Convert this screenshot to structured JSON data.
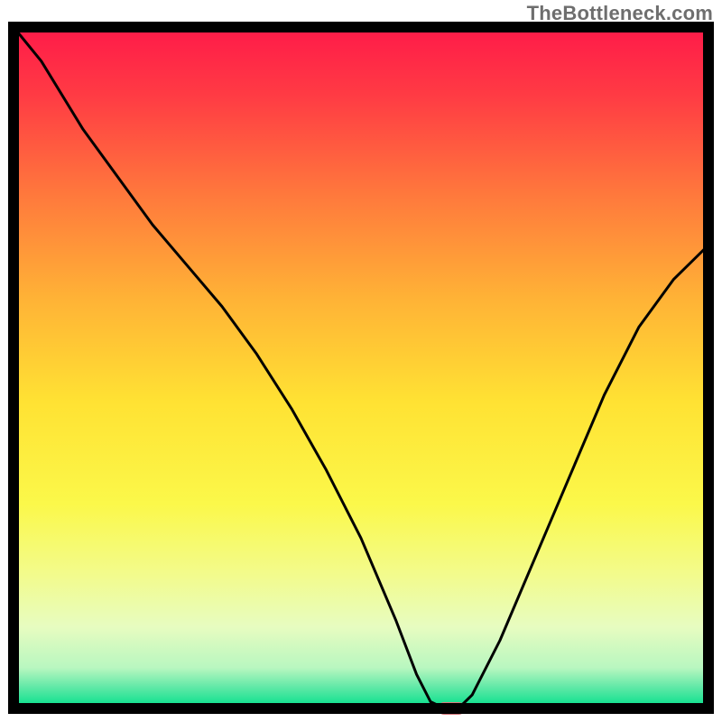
{
  "watermark": "TheBottleneck.com",
  "chart_data": {
    "type": "line",
    "title": "",
    "xlabel": "",
    "ylabel": "",
    "xlim": [
      0,
      100
    ],
    "ylim": [
      0,
      100
    ],
    "series": [
      {
        "name": "bottleneck-curve",
        "x": [
          0,
          4,
          10,
          15,
          20,
          25,
          30,
          35,
          40,
          45,
          50,
          55,
          58,
          60,
          62,
          64,
          66,
          70,
          75,
          80,
          85,
          90,
          95,
          100
        ],
        "values": [
          100,
          95,
          85,
          78,
          71,
          65,
          59,
          52,
          44,
          35,
          25,
          13,
          5,
          1,
          0,
          0,
          2,
          10,
          22,
          34,
          46,
          56,
          63,
          68
        ]
      }
    ],
    "marker": {
      "x": 63,
      "y": 0
    },
    "gradient_stops": [
      {
        "offset": 0.0,
        "color": "#ff1a49"
      },
      {
        "offset": 0.1,
        "color": "#ff3b44"
      },
      {
        "offset": 0.25,
        "color": "#ff7a3c"
      },
      {
        "offset": 0.4,
        "color": "#ffb336"
      },
      {
        "offset": 0.55,
        "color": "#ffe233"
      },
      {
        "offset": 0.7,
        "color": "#fbf84a"
      },
      {
        "offset": 0.8,
        "color": "#f3fb8a"
      },
      {
        "offset": 0.88,
        "color": "#e7fcc0"
      },
      {
        "offset": 0.94,
        "color": "#b9f7c0"
      },
      {
        "offset": 0.97,
        "color": "#5de8a6"
      },
      {
        "offset": 1.0,
        "color": "#00e08a"
      }
    ],
    "frame_color": "#000000",
    "line_color": "#000000",
    "marker_color": "#d97b7e"
  }
}
